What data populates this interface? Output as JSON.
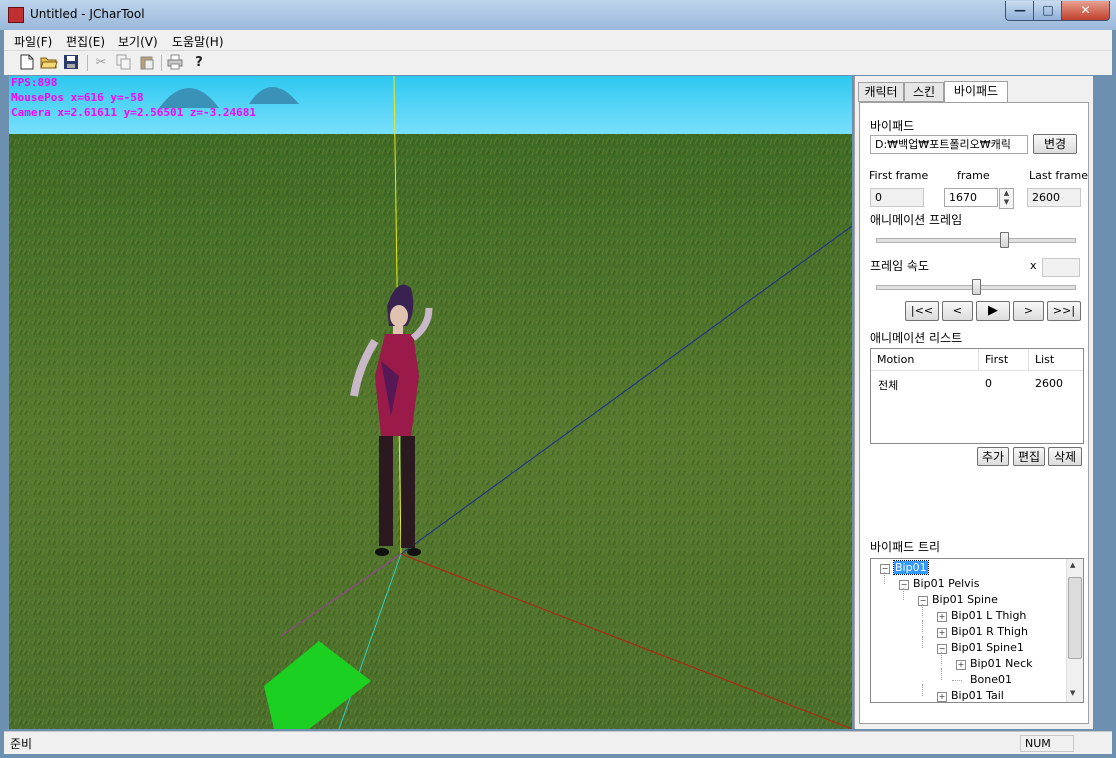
{
  "window": {
    "title": "Untitled - JCharTool"
  },
  "menu": [
    "파일(F)",
    "편집(E)",
    "보기(V)",
    "도움말(H)"
  ],
  "toolbar": {
    "icons": [
      "new-file-icon",
      "open-folder-icon",
      "save-icon",
      "cut-icon",
      "copy-icon",
      "paste-icon",
      "print-icon",
      "help-icon"
    ]
  },
  "viewport": {
    "hud": [
      "FPS:898",
      "MousePos x=616 y=-58",
      "Camera x=2.61611 y=2.56501 z=-3.24681"
    ],
    "hud_color": "#ff00ff"
  },
  "panel": {
    "tabs": [
      "캐릭터",
      "스킨",
      "바이패드"
    ],
    "active_tab": "바이패드",
    "biped_label": "바이패드",
    "biped_path": "D:₩백업₩포트폴리오₩캐릭",
    "change_button": "변경",
    "first_frame_label": "First frame",
    "frame_label": "frame",
    "last_frame_label": "Last frame",
    "first_frame": "0",
    "frame": "1670",
    "last_frame": "2600",
    "anim_frame_label": "애니메이션 프레임",
    "frame_speed_label": "프레임 속도",
    "speed_x_label": "x",
    "speed_value": "",
    "anim_frame_position": 0.64,
    "frame_speed_position": 0.5,
    "playback": [
      "|<<",
      "<",
      "▶",
      ">",
      ">>|"
    ],
    "anim_list_label": "애니메이션 리스트",
    "list_headers": [
      "Motion",
      "First",
      "List"
    ],
    "list_rows": [
      {
        "motion": "전체",
        "first": "0",
        "list": "2600"
      }
    ],
    "add_button": "추가",
    "edit_button": "편집",
    "delete_button": "삭제",
    "tree_label": "바이패드 트리",
    "tree": [
      {
        "label": "Bip01",
        "level": 0,
        "toggle": "−",
        "selected": true
      },
      {
        "label": "Bip01 Pelvis",
        "level": 1,
        "toggle": "−"
      },
      {
        "label": "Bip01 Spine",
        "level": 2,
        "toggle": "−"
      },
      {
        "label": "Bip01 L Thigh",
        "level": 3,
        "toggle": "+"
      },
      {
        "label": "Bip01 R Thigh",
        "level": 3,
        "toggle": "+"
      },
      {
        "label": "Bip01 Spine1",
        "level": 3,
        "toggle": "−"
      },
      {
        "label": "Bip01 Neck",
        "level": 4,
        "toggle": "+"
      },
      {
        "label": "Bone01",
        "level": 4,
        "toggle": ""
      },
      {
        "label": "Bip01 Tail",
        "level": 3,
        "toggle": "+"
      }
    ]
  },
  "status": {
    "text": "준비",
    "num": "NUM"
  }
}
